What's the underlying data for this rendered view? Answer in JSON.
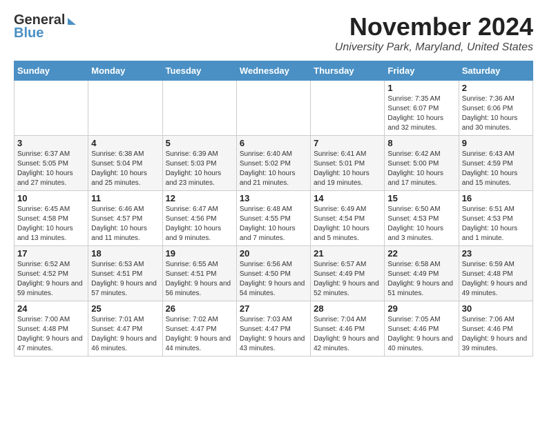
{
  "header": {
    "logo_general": "General",
    "logo_blue": "Blue",
    "month_title": "November 2024",
    "location": "University Park, Maryland, United States"
  },
  "days_of_week": [
    "Sunday",
    "Monday",
    "Tuesday",
    "Wednesday",
    "Thursday",
    "Friday",
    "Saturday"
  ],
  "weeks": [
    [
      {
        "day": "",
        "info": ""
      },
      {
        "day": "",
        "info": ""
      },
      {
        "day": "",
        "info": ""
      },
      {
        "day": "",
        "info": ""
      },
      {
        "day": "",
        "info": ""
      },
      {
        "day": "1",
        "info": "Sunrise: 7:35 AM\nSunset: 6:07 PM\nDaylight: 10 hours and 32 minutes."
      },
      {
        "day": "2",
        "info": "Sunrise: 7:36 AM\nSunset: 6:06 PM\nDaylight: 10 hours and 30 minutes."
      }
    ],
    [
      {
        "day": "3",
        "info": "Sunrise: 6:37 AM\nSunset: 5:05 PM\nDaylight: 10 hours and 27 minutes."
      },
      {
        "day": "4",
        "info": "Sunrise: 6:38 AM\nSunset: 5:04 PM\nDaylight: 10 hours and 25 minutes."
      },
      {
        "day": "5",
        "info": "Sunrise: 6:39 AM\nSunset: 5:03 PM\nDaylight: 10 hours and 23 minutes."
      },
      {
        "day": "6",
        "info": "Sunrise: 6:40 AM\nSunset: 5:02 PM\nDaylight: 10 hours and 21 minutes."
      },
      {
        "day": "7",
        "info": "Sunrise: 6:41 AM\nSunset: 5:01 PM\nDaylight: 10 hours and 19 minutes."
      },
      {
        "day": "8",
        "info": "Sunrise: 6:42 AM\nSunset: 5:00 PM\nDaylight: 10 hours and 17 minutes."
      },
      {
        "day": "9",
        "info": "Sunrise: 6:43 AM\nSunset: 4:59 PM\nDaylight: 10 hours and 15 minutes."
      }
    ],
    [
      {
        "day": "10",
        "info": "Sunrise: 6:45 AM\nSunset: 4:58 PM\nDaylight: 10 hours and 13 minutes."
      },
      {
        "day": "11",
        "info": "Sunrise: 6:46 AM\nSunset: 4:57 PM\nDaylight: 10 hours and 11 minutes."
      },
      {
        "day": "12",
        "info": "Sunrise: 6:47 AM\nSunset: 4:56 PM\nDaylight: 10 hours and 9 minutes."
      },
      {
        "day": "13",
        "info": "Sunrise: 6:48 AM\nSunset: 4:55 PM\nDaylight: 10 hours and 7 minutes."
      },
      {
        "day": "14",
        "info": "Sunrise: 6:49 AM\nSunset: 4:54 PM\nDaylight: 10 hours and 5 minutes."
      },
      {
        "day": "15",
        "info": "Sunrise: 6:50 AM\nSunset: 4:53 PM\nDaylight: 10 hours and 3 minutes."
      },
      {
        "day": "16",
        "info": "Sunrise: 6:51 AM\nSunset: 4:53 PM\nDaylight: 10 hours and 1 minute."
      }
    ],
    [
      {
        "day": "17",
        "info": "Sunrise: 6:52 AM\nSunset: 4:52 PM\nDaylight: 9 hours and 59 minutes."
      },
      {
        "day": "18",
        "info": "Sunrise: 6:53 AM\nSunset: 4:51 PM\nDaylight: 9 hours and 57 minutes."
      },
      {
        "day": "19",
        "info": "Sunrise: 6:55 AM\nSunset: 4:51 PM\nDaylight: 9 hours and 56 minutes."
      },
      {
        "day": "20",
        "info": "Sunrise: 6:56 AM\nSunset: 4:50 PM\nDaylight: 9 hours and 54 minutes."
      },
      {
        "day": "21",
        "info": "Sunrise: 6:57 AM\nSunset: 4:49 PM\nDaylight: 9 hours and 52 minutes."
      },
      {
        "day": "22",
        "info": "Sunrise: 6:58 AM\nSunset: 4:49 PM\nDaylight: 9 hours and 51 minutes."
      },
      {
        "day": "23",
        "info": "Sunrise: 6:59 AM\nSunset: 4:48 PM\nDaylight: 9 hours and 49 minutes."
      }
    ],
    [
      {
        "day": "24",
        "info": "Sunrise: 7:00 AM\nSunset: 4:48 PM\nDaylight: 9 hours and 47 minutes."
      },
      {
        "day": "25",
        "info": "Sunrise: 7:01 AM\nSunset: 4:47 PM\nDaylight: 9 hours and 46 minutes."
      },
      {
        "day": "26",
        "info": "Sunrise: 7:02 AM\nSunset: 4:47 PM\nDaylight: 9 hours and 44 minutes."
      },
      {
        "day": "27",
        "info": "Sunrise: 7:03 AM\nSunset: 4:47 PM\nDaylight: 9 hours and 43 minutes."
      },
      {
        "day": "28",
        "info": "Sunrise: 7:04 AM\nSunset: 4:46 PM\nDaylight: 9 hours and 42 minutes."
      },
      {
        "day": "29",
        "info": "Sunrise: 7:05 AM\nSunset: 4:46 PM\nDaylight: 9 hours and 40 minutes."
      },
      {
        "day": "30",
        "info": "Sunrise: 7:06 AM\nSunset: 4:46 PM\nDaylight: 9 hours and 39 minutes."
      }
    ]
  ]
}
